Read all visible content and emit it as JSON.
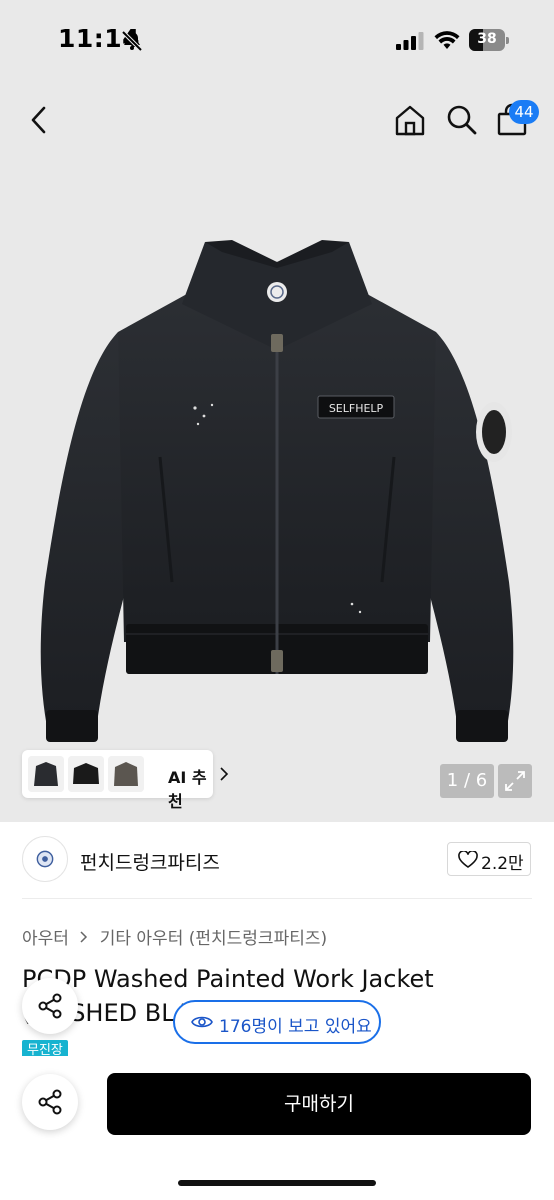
{
  "status_bar": {
    "time": "11:14",
    "battery": "38"
  },
  "nav": {
    "cart_count": "44",
    "icons": [
      "back-icon",
      "home-icon",
      "search-icon",
      "cart-icon"
    ]
  },
  "hero": {
    "patch_text": "SELFHELP",
    "ai_recommend_label": "AI 추천",
    "page_counter": "1 / 6"
  },
  "brand": {
    "name": "펀치드렁크파티즈",
    "likes": "2.2만"
  },
  "breadcrumb": {
    "category": "아우터",
    "subcategory": "기타 아우터 (펀치드렁크파티즈)"
  },
  "product": {
    "title": "PCDP Washed Painted Work Jacket (WASHED BLACK)",
    "viewers": "176명이 보고 있어요",
    "badge": "무진장"
  },
  "bottom": {
    "buy_label": "구매하기"
  },
  "colors": {
    "accent": "#1a7cf5",
    "badge": "#17b3d0",
    "buy": "#000000"
  }
}
